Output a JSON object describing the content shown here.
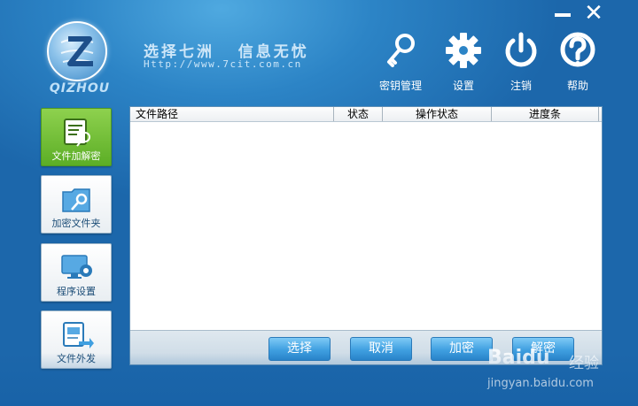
{
  "logo": {
    "name": "QIZHOU"
  },
  "header": {
    "slogan": "选择七洲   信息无忧",
    "url": "Http://www.7cit.com.cn"
  },
  "window_controls": {
    "minimize": "—",
    "close": "✕"
  },
  "toolbar": [
    {
      "label": "密钥管理",
      "icon": "key-icon"
    },
    {
      "label": "设置",
      "icon": "gear-icon"
    },
    {
      "label": "注销",
      "icon": "power-icon"
    },
    {
      "label": "帮助",
      "icon": "help-icon"
    }
  ],
  "sidebar": [
    {
      "label": "文件加解密",
      "icon": "file-encrypt-icon",
      "active": true
    },
    {
      "label": "加密文件夹",
      "icon": "folder-key-icon",
      "active": false
    },
    {
      "label": "程序设置",
      "icon": "monitor-gear-icon",
      "active": false
    },
    {
      "label": "文件外发",
      "icon": "file-send-icon",
      "active": false
    }
  ],
  "table": {
    "columns": [
      "文件路径",
      "状态",
      "操作状态",
      "进度条"
    ],
    "rows": []
  },
  "actions": [
    "选择",
    "取消",
    "加密",
    "解密"
  ],
  "watermark": {
    "brand": "Baidu",
    "sub": "经验",
    "url": "jingyan.baidu.com"
  },
  "colors": {
    "background": "#2c84c6",
    "active_tab": "#6cbf34",
    "button": "#3f9fe0"
  }
}
